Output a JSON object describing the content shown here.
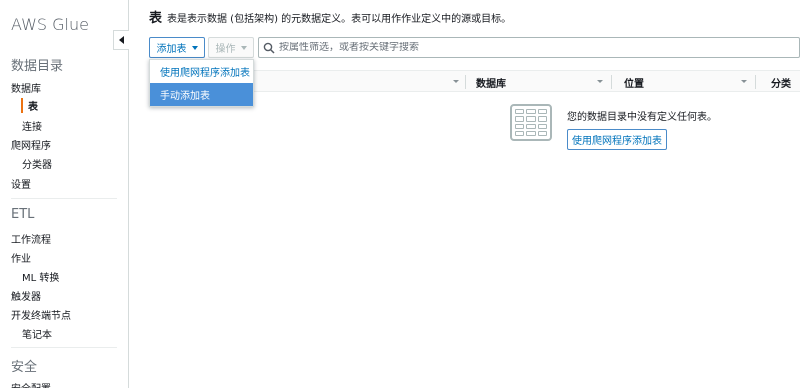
{
  "app": {
    "title": "AWS Glue"
  },
  "sidebar": {
    "sections": [
      {
        "label": "数据目录"
      },
      {
        "label": "ETL"
      },
      {
        "label": "安全"
      }
    ],
    "items": [
      {
        "label": "数据库"
      },
      {
        "label": "表"
      },
      {
        "label": "连接"
      },
      {
        "label": "爬网程序"
      },
      {
        "label": "分类器"
      },
      {
        "label": "设置"
      },
      {
        "label": "工作流程"
      },
      {
        "label": "作业"
      },
      {
        "label": "ML 转换"
      },
      {
        "label": "触发器"
      },
      {
        "label": "开发终端节点"
      },
      {
        "label": "笔记本"
      },
      {
        "label": "安全配置"
      }
    ]
  },
  "main": {
    "title": "表",
    "description": "表是表示数据 (包括架构) 的元数据定义。表可以用作作业定义中的源或目标。",
    "toolbar": {
      "add_label": "添加表",
      "action_label": "操作",
      "search_placeholder": "按属性筛选，或者按关键字搜索"
    },
    "dropdown": {
      "items": [
        {
          "label": "使用爬网程序添加表"
        },
        {
          "label": "手动添加表"
        }
      ]
    },
    "table": {
      "columns": [
        {
          "label": ""
        },
        {
          "label": "数据库"
        },
        {
          "label": "位置"
        },
        {
          "label": "分类"
        }
      ]
    },
    "empty_state": {
      "message": "您的数据目录中没有定义任何表。",
      "button_label": "使用爬网程序添加表"
    }
  },
  "colors": {
    "accent": "#0073bb",
    "active_marker": "#ec7211",
    "highlight": "#4a90d9"
  }
}
